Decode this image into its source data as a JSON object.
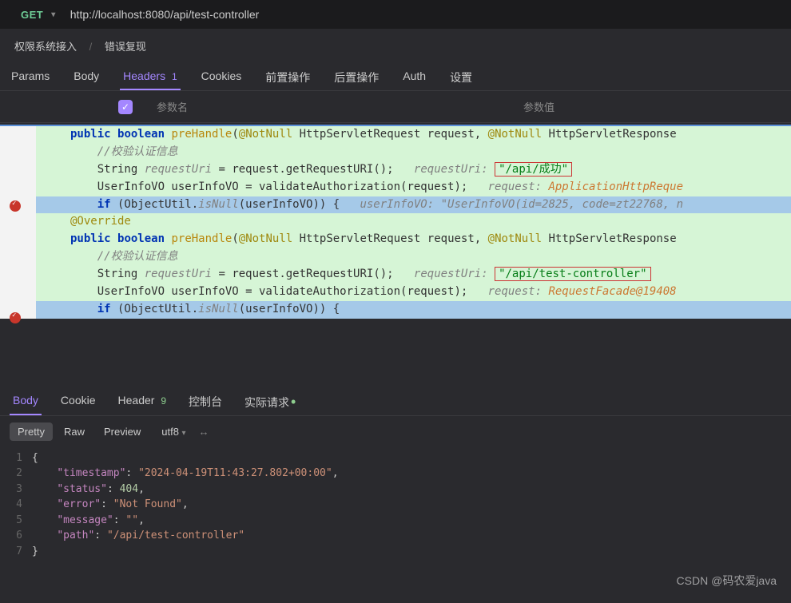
{
  "request": {
    "method": "GET",
    "url": "http://localhost:8080/api/test-controller"
  },
  "breadcrumb": {
    "a": "权限系统接入",
    "b": "错误复现"
  },
  "reqTabs": {
    "params": "Params",
    "body": "Body",
    "headers": "Headers",
    "headersBadge": "1",
    "cookies": "Cookies",
    "pre": "前置操作",
    "post": "后置操作",
    "auth": "Auth",
    "settings": "设置"
  },
  "paramsHeader": {
    "name": "参数名",
    "value": "参数值"
  },
  "code": {
    "l1a": "public",
    "l1b": "boolean",
    "l1c": "preHandle",
    "l1d": "(",
    "l1e": "@NotNull",
    "l1f": " HttpServletRequest request, ",
    "l1g": "@NotNull",
    "l1h": " HttpServletResponse",
    "l2": "//校验认证信息",
    "l3a": "String ",
    "l3b": "requestUri",
    "l3c": " = request.getRequestURI();   ",
    "l3hint": "requestUri:",
    "l3val": "\"/api/成功\"",
    "l4a": "UserInfoVO userInfoVO = validateAuthorization(request);   ",
    "l4hint": "request: ",
    "l4rest": "ApplicationHttpReque",
    "l5a": "if",
    "l5b": " (ObjectUtil.",
    "l5c": "isNull",
    "l5d": "(userInfoVO)) {   ",
    "l5hint": "userInfoVO: \"UserInfoVO(id=2825, code=zt22768, n",
    "l6": "@Override",
    "l7a": "public",
    "l7b": "boolean",
    "l7c": "preHandle",
    "l7d": "(",
    "l7e": "@NotNull",
    "l7f": " HttpServletRequest request, ",
    "l7g": "@NotNull",
    "l7h": " HttpServletResponse",
    "l8": "//校验认证信息",
    "l9a": "String ",
    "l9b": "requestUri",
    "l9c": " = request.getRequestURI();   ",
    "l9hint": "requestUri:",
    "l9val": "\"/api/test-controller\"",
    "l10a": "UserInfoVO userInfoVO = validateAuthorization(request);   ",
    "l10hint": "request: ",
    "l10rest": "RequestFacade@19408",
    "l11a": "if",
    "l11b": " (ObjectUtil.",
    "l11c": "isNull",
    "l11d": "(userInfoVO)) {"
  },
  "respTabs": {
    "body": "Body",
    "cookie": "Cookie",
    "header": "Header",
    "headerBadge": "9",
    "console": "控制台",
    "actual": "实际请求"
  },
  "viewBar": {
    "pretty": "Pretty",
    "raw": "Raw",
    "preview": "Preview",
    "enc": "utf8"
  },
  "json": {
    "l1": "{",
    "l2k": "\"timestamp\"",
    "l2v": "\"2024-04-19T11:43:27.802+00:00\"",
    "l3k": "\"status\"",
    "l3v": "404",
    "l4k": "\"error\"",
    "l4v": "\"Not Found\"",
    "l5k": "\"message\"",
    "l5v": "\"\"",
    "l6k": "\"path\"",
    "l6v": "\"/api/test-controller\"",
    "l7": "}"
  },
  "watermark": "CSDN @码农爱java"
}
